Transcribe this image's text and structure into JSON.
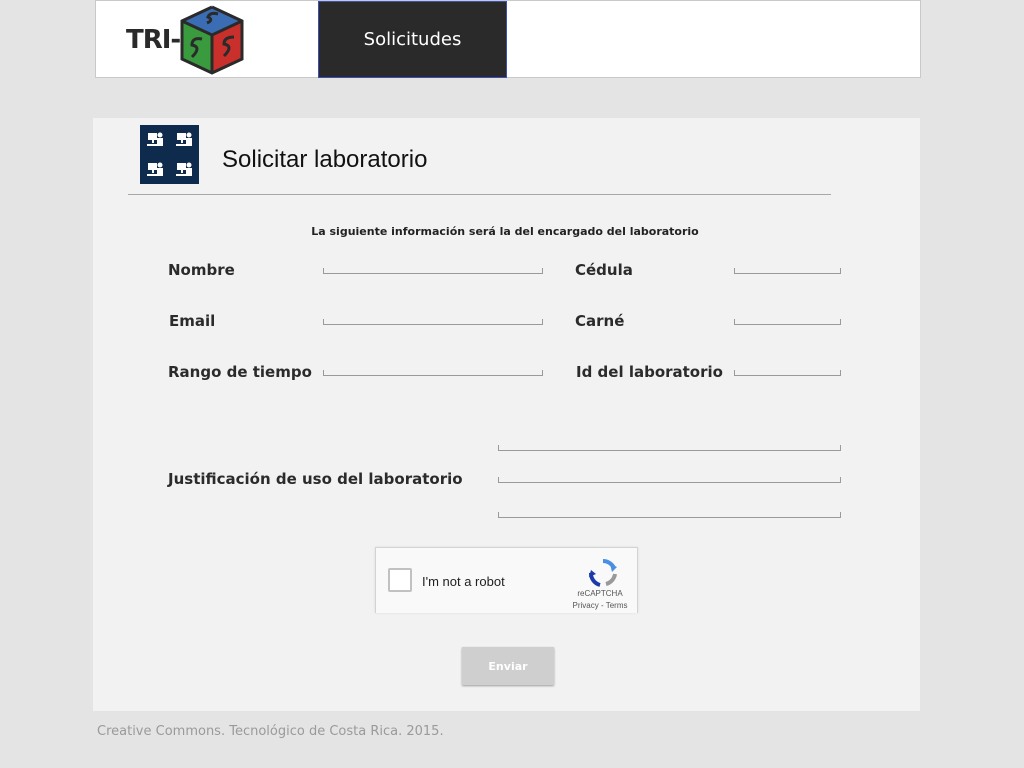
{
  "header": {
    "logo_text": "TRI-",
    "nav_tab": "Solicitudes"
  },
  "form": {
    "title": "Solicitar laboratorio",
    "subtitle": "La siguiente información será la del encargado del laboratorio",
    "labels": {
      "nombre": "Nombre",
      "cedula": "Cédula",
      "email": "Email",
      "carne": "Carné",
      "rango": "Rango de tiempo",
      "id_lab": "Id del laboratorio",
      "justificacion": "Justificación de uso del laboratorio"
    },
    "captcha": {
      "label": "I'm not a robot",
      "brand": "reCAPTCHA",
      "links": "Privacy - Terms"
    },
    "submit_label": "Enviar"
  },
  "footer": {
    "text": "Creative Commons. Tecnológico de Costa Rica. 2015."
  },
  "colors": {
    "background": "#e4e4e4",
    "card": "#f2f2f2",
    "nav_tab": "#2a2a2a",
    "icon_bg": "#0e2a4d",
    "submit": "#cfcfcf"
  }
}
